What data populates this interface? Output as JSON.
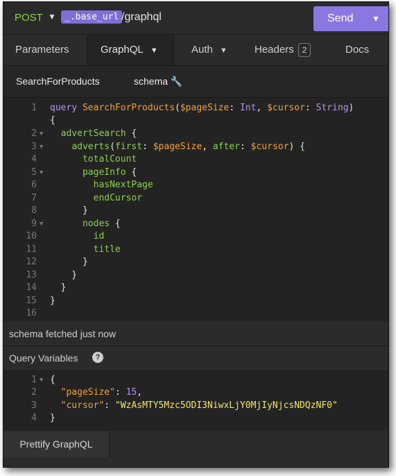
{
  "url_bar": {
    "method": "POST",
    "base_url": "_.base_url",
    "path": "/graphql",
    "send_label": "Send"
  },
  "tabs": [
    {
      "label": "Parameters"
    },
    {
      "label": "GraphQL"
    },
    {
      "label": "Auth"
    },
    {
      "label": "Headers",
      "badge": "2"
    },
    {
      "label": "Docs"
    }
  ],
  "subtabs": {
    "operation": "SearchForProducts",
    "schema": "schema"
  },
  "editor": {
    "line_numbers": [
      "1",
      "2",
      "3",
      "4",
      "5",
      "6",
      "7",
      "8",
      "9",
      "10",
      "11",
      "12",
      "13",
      "14",
      "15",
      "16"
    ],
    "lines": [
      "query SearchForProducts($pageSize: Int, $cursor: String)",
      "{",
      "  advertSearch {",
      "    adverts(first: $pageSize, after: $cursor) {",
      "      totalCount",
      "      pageInfo {",
      "        hasNextPage",
      "        endCursor",
      "      }",
      "      nodes {",
      "        id",
      "        title",
      "      }",
      "    }",
      "  }",
      "}",
      ""
    ]
  },
  "status": "schema fetched just now",
  "query_variables": {
    "title": "Query Variables",
    "line_numbers": [
      "1",
      "2",
      "3",
      "4"
    ],
    "lines": [
      "{",
      "  \"pageSize\": 15,",
      "  \"cursor\": \"WzAsMTY5Mzc5ODI3NiwxLjY0MjIyNjcsNDQzNF0\"",
      "}"
    ]
  },
  "footer": {
    "prettify_label": "Prettify GraphQL"
  },
  "colors": {
    "accent": "#8a78e0",
    "method": "#8bd14f",
    "variable": "#f2a23b",
    "keyword": "#b392f0",
    "string": "#f5e663"
  }
}
